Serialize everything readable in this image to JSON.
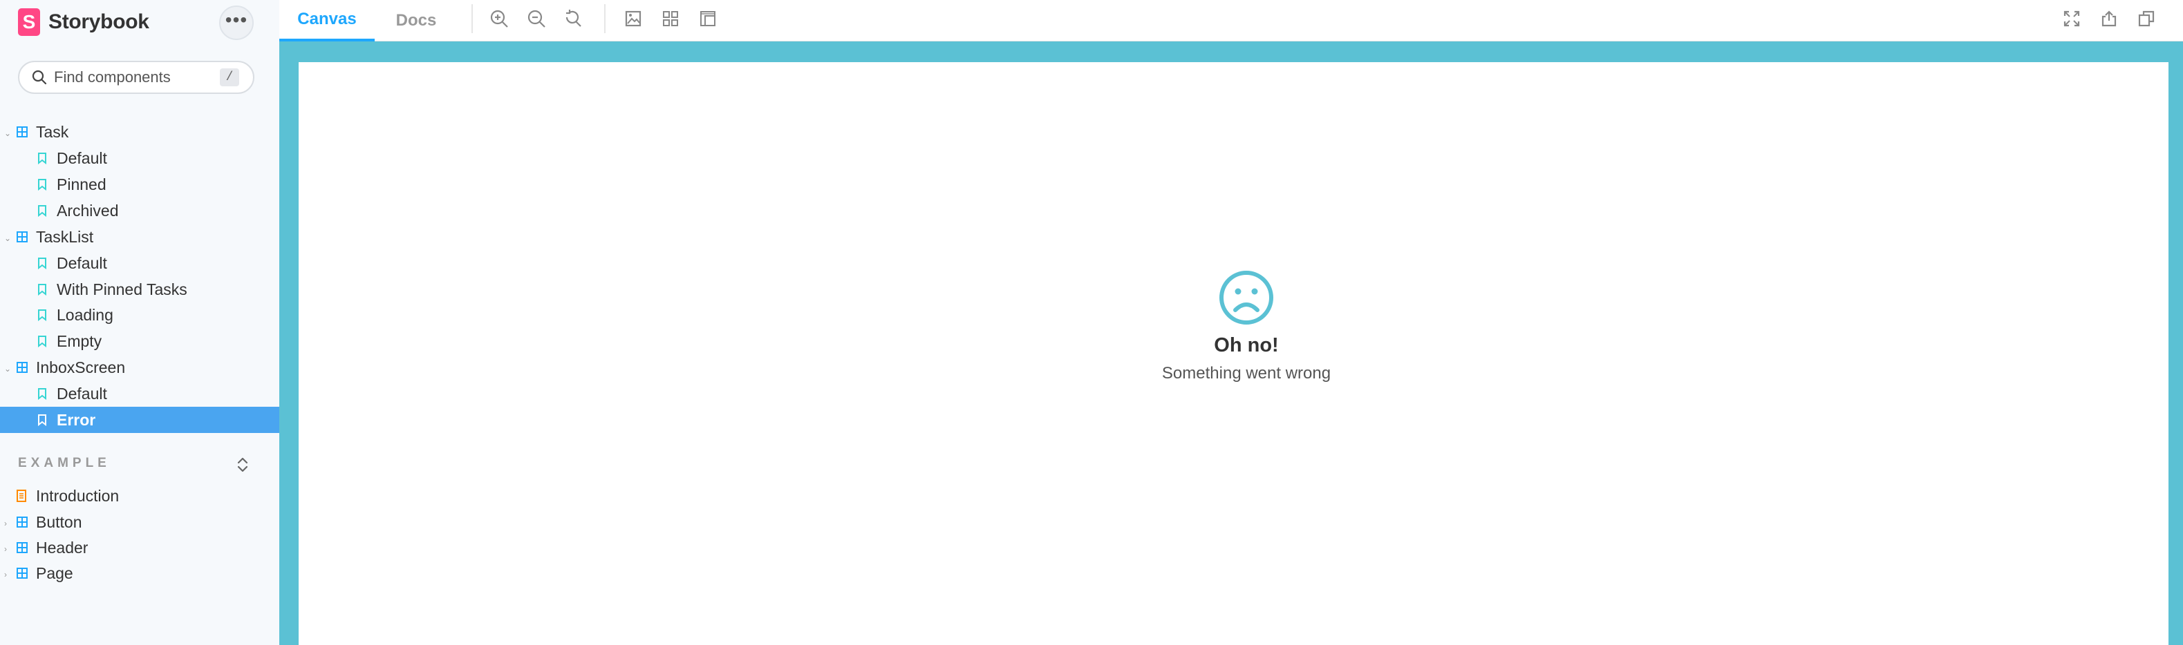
{
  "brand": {
    "name": "Storybook",
    "logo_letter": "S",
    "color": "#ff4785"
  },
  "search": {
    "placeholder": "Find components",
    "shortcut": "/"
  },
  "sidebar": {
    "groups": [
      {
        "label": "Task",
        "stories": [
          "Default",
          "Pinned",
          "Archived"
        ]
      },
      {
        "label": "TaskList",
        "stories": [
          "Default",
          "With Pinned Tasks",
          "Loading",
          "Empty"
        ]
      },
      {
        "label": "InboxScreen",
        "stories": [
          "Default",
          "Error"
        ]
      }
    ],
    "selected_story": "Error",
    "section_title": "EXAMPLE",
    "section_items": [
      {
        "label": "Introduction",
        "type": "docs"
      },
      {
        "label": "Button",
        "type": "component"
      },
      {
        "label": "Header",
        "type": "component"
      },
      {
        "label": "Page",
        "type": "component"
      }
    ]
  },
  "toolbar": {
    "tabs": [
      {
        "label": "Canvas",
        "active": true
      },
      {
        "label": "Docs",
        "active": false
      }
    ],
    "left_icons": [
      "zoom-in-icon",
      "zoom-out-icon",
      "zoom-reset-icon",
      "background-icon",
      "grid-icon",
      "measure-icon"
    ],
    "right_icons": [
      "fullscreen-icon",
      "share-icon",
      "copy-link-icon"
    ]
  },
  "canvas": {
    "frame_color": "#5bc1d4",
    "error_title": "Oh no!",
    "error_subtitle": "Something went wrong",
    "icon": "sad-face-icon"
  },
  "colors": {
    "accent": "#1ea7fd",
    "selected": "#4aa5f0",
    "component_icon": "#1ea7fd",
    "story_icon": "#37d5d3",
    "docs_icon": "#ff8a00"
  }
}
